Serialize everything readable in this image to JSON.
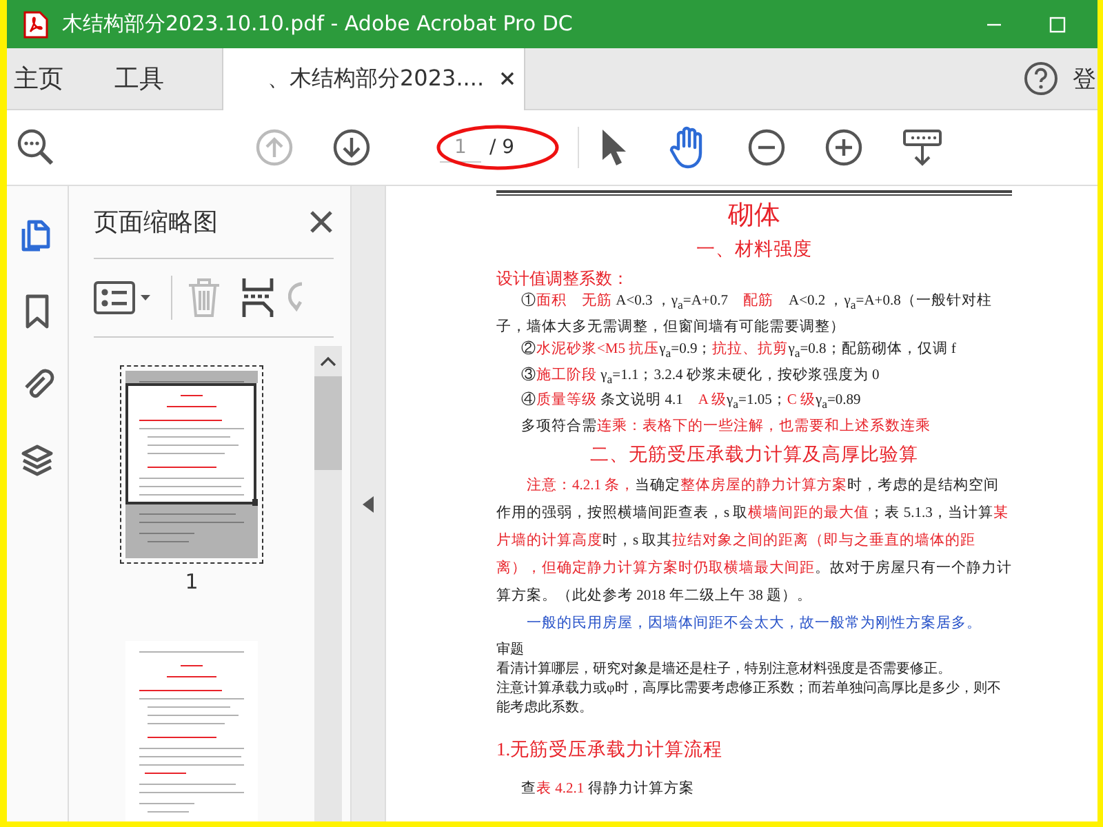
{
  "window": {
    "title": "木结构部分2023.10.10.pdf - Adobe Acrobat Pro DC"
  },
  "nav_tabs": [
    {
      "label": "主页",
      "selected": false
    },
    {
      "label": "工具",
      "selected": false
    }
  ],
  "document_tab": {
    "label": "、木结构部分2023....",
    "selected": true
  },
  "header_link": "登",
  "toolbar": {
    "previous_page": {
      "disabled": true
    },
    "next_page": {
      "disabled": false
    },
    "page_value": "1",
    "page_total": "/ 9",
    "select_tool": {
      "selected": false
    },
    "hand_tool": {
      "selected": true
    }
  },
  "side_rail": [
    {
      "kind": "pages",
      "selected": true
    },
    {
      "kind": "bookmarks",
      "selected": false
    },
    {
      "kind": "attachments",
      "selected": false
    },
    {
      "kind": "layers",
      "selected": false
    }
  ],
  "thumbnails_panel": {
    "title": "页面缩略图",
    "pages": [
      {
        "label": "1",
        "selected": true
      },
      {
        "selected": false
      }
    ]
  },
  "document": {
    "blocks": [
      {
        "kind": "title",
        "runs": [
          {
            "text": "砌体",
            "color": "#e8232a"
          }
        ]
      },
      {
        "kind": "section",
        "runs": [
          {
            "text": "一、材料强度",
            "color": "#e8232a"
          }
        ]
      },
      {
        "kind": "label",
        "runs": [
          {
            "text": "设计值调整系数：",
            "color": "#e8232a"
          }
        ]
      },
      {
        "kind": "item",
        "runs": [
          {
            "text": "①",
            "color": "#222222"
          },
          {
            "text": "面积　无筋",
            "color": "#e8232a"
          },
          {
            "text": " A<0.3 ，γ$_{a}$=A+0.7　",
            "color": "#222222"
          },
          {
            "text": "配筋",
            "color": "#e8232a"
          },
          {
            "text": "　A<0.2 ，γ$_{a}$=A+0.8（一般针对柱子，墙体大多无需调整，但窗间墙有可能需要调整）",
            "color": "#222222"
          }
        ]
      },
      {
        "kind": "item",
        "runs": [
          {
            "text": "②",
            "color": "#222222"
          },
          {
            "text": "水泥砂浆<M5 抗压",
            "color": "#e8232a"
          },
          {
            "text": "γ$_{a}$=0.9；",
            "color": "#222222"
          },
          {
            "text": "抗拉、抗剪",
            "color": "#e8232a"
          },
          {
            "text": "γ$_{a}$=0.8；配筋砌体，仅调 f",
            "color": "#222222"
          }
        ]
      },
      {
        "kind": "item",
        "runs": [
          {
            "text": "③",
            "color": "#222222"
          },
          {
            "text": "施工阶段",
            "color": "#e8232a"
          },
          {
            "text": " γ$_{a}$=1.1；3.2.4 砂浆未硬化，按砂浆强度为 0",
            "color": "#222222"
          }
        ]
      },
      {
        "kind": "item",
        "runs": [
          {
            "text": "④",
            "color": "#222222"
          },
          {
            "text": "质量等级",
            "color": "#e8232a"
          },
          {
            "text": " 条文说明 4.1　",
            "color": "#222222"
          },
          {
            "text": "A 级",
            "color": "#e8232a"
          },
          {
            "text": "γ$_{a}$=1.05；",
            "color": "#222222"
          },
          {
            "text": "C 级",
            "color": "#e8232a"
          },
          {
            "text": "γ$_{a}$=0.89",
            "color": "#222222"
          }
        ]
      },
      {
        "kind": "item",
        "runs": [
          {
            "text": "多项符合需",
            "color": "#222222"
          },
          {
            "text": "连乘：表格下的一些注解，也需要和上述系数连乘",
            "color": "#e8232a"
          }
        ]
      },
      {
        "kind": "section",
        "runs": [
          {
            "text": "二、无筋受压承载力计算及高厚比验算",
            "color": "#e8232a"
          }
        ]
      },
      {
        "kind": "para",
        "runs": [
          {
            "text": "注意：4.2.1 条，",
            "color": "#e8232a"
          },
          {
            "text": "当确定",
            "color": "#222222"
          },
          {
            "text": "整体房屋的静力计算方案",
            "color": "#e8232a"
          },
          {
            "text": "时，考虑的是结构空间作用的强弱，按照横墙间距查表，s 取",
            "color": "#222222"
          },
          {
            "text": "横墙间距的最大值",
            "color": "#e8232a"
          },
          {
            "text": "；表 5.1.3，当计算",
            "color": "#222222"
          },
          {
            "text": "某片墙的计算高度",
            "color": "#e8232a"
          },
          {
            "text": "时，s 取其",
            "color": "#222222"
          },
          {
            "text": "拉结对象之间的距离（即与之垂直的墙体的距离），但确定静力计算方案时仍取横墙最大间距",
            "color": "#e8232a"
          },
          {
            "text": "。故对于房屋只有一个静力计算方案。（此处参考 2018 年二级上午 38 题）。",
            "color": "#222222"
          }
        ]
      },
      {
        "kind": "note",
        "runs": [
          {
            "text": "一般的民用房屋，因墙体间距不会太大，故一般常为刚性方案居多。",
            "color": "#2550c8"
          }
        ]
      },
      {
        "kind": "small",
        "runs": [
          {
            "text": "审题",
            "color": "#222222"
          }
        ]
      },
      {
        "kind": "small",
        "runs": [
          {
            "text": "看清计算哪层，研究对象是墙还是柱子，特别注意材料强度是否需要修正。",
            "color": "#222222"
          }
        ]
      },
      {
        "kind": "small",
        "runs": [
          {
            "text": "注意计算承载力或φ时，高厚比需要考虑修正系数；而若单独问高厚比是多少，则不能考虑此系数。",
            "color": "#222222"
          }
        ]
      },
      {
        "kind": "heading",
        "runs": [
          {
            "text": "1.无筋受压承载力计算流程",
            "color": "#e8232a"
          }
        ]
      },
      {
        "kind": "item",
        "runs": [
          {
            "text": "查",
            "color": "#222222"
          },
          {
            "text": "表 4.2.1",
            "color": "#e8232a"
          },
          {
            "text": " 得静力计算方案",
            "color": "#222222"
          }
        ]
      }
    ]
  }
}
